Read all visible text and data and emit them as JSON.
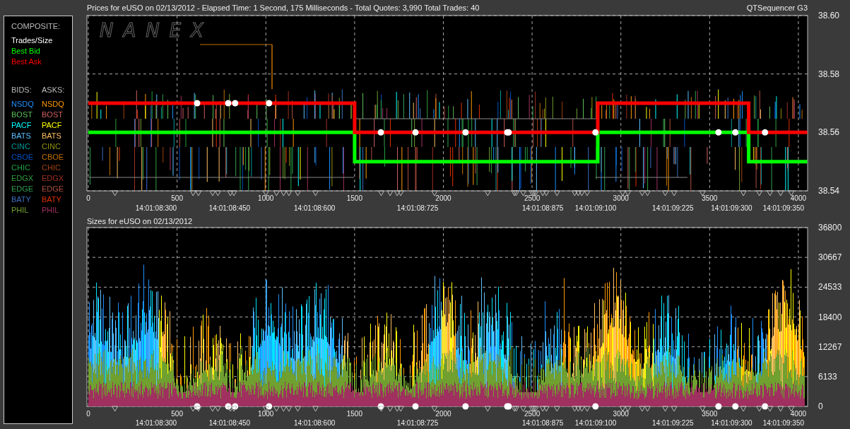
{
  "legend": {
    "composite_title": "COMPOSITE:",
    "trades_label": {
      "label": "Trades/Size",
      "color": "#ffffff"
    },
    "bids_title": "BIDS:",
    "asks_title": "ASKS:",
    "exchanges": [
      {
        "bid": {
          "label": "NSDQ",
          "color": "#1e90ff"
        },
        "ask": {
          "label": "NSDQ",
          "color": "#ff9900"
        }
      },
      {
        "bid": {
          "label": "BOST",
          "color": "#5cc05c"
        },
        "ask": {
          "label": "BOST",
          "color": "#d06060"
        }
      },
      {
        "bid": {
          "label": "PACF",
          "color": "#00ffff"
        },
        "ask": {
          "label": "PACF",
          "color": "#ffff00"
        }
      },
      {
        "bid": {
          "label": "BATS",
          "color": "#5bc0ff"
        },
        "ask": {
          "label": "BATS",
          "color": "#ffc060"
        }
      },
      {
        "bid": {
          "label": "CINC",
          "color": "#009999"
        },
        "ask": {
          "label": "CINC",
          "color": "#909010"
        }
      },
      {
        "bid": {
          "label": "CBOE",
          "color": "#0050c0"
        },
        "ask": {
          "label": "CBOE",
          "color": "#c07000"
        }
      },
      {
        "bid": {
          "label": "CHIC",
          "color": "#20a040"
        },
        "ask": {
          "label": "CHIC",
          "color": "#a04010"
        }
      },
      {
        "bid": {
          "label": "EDGX",
          "color": "#30a040"
        },
        "ask": {
          "label": "EDGX",
          "color": "#a03020"
        }
      },
      {
        "bid": {
          "label": "EDGE",
          "color": "#30a050"
        },
        "ask": {
          "label": "EDGE",
          "color": "#b05040"
        }
      },
      {
        "bid": {
          "label": "BATY",
          "color": "#3a70c0"
        },
        "ask": {
          "label": "BATY",
          "color": "#e03000"
        }
      },
      {
        "bid": {
          "label": "PHIL",
          "color": "#70a030"
        },
        "ask": {
          "label": "PHIL",
          "color": "#a03060"
        }
      }
    ]
  },
  "prices_panel": {
    "title": "Prices for eUSO on 02/13/2012 - Elapsed Time: 1 Second, 175 Milliseconds - Total Quotes: 3,990 Total Trades: 40",
    "app_name": "QTSequencer G3",
    "watermark": "NANEX",
    "time_labels": [
      "14:01:08:300",
      "14:01:08:450",
      "14:01:08:600",
      "14:01:08:725",
      "14:01:08:875",
      "14:01:09:100",
      "14:01:09:225",
      "14:01:09:300",
      "14:01:09:350"
    ],
    "chart_data": {
      "type": "line",
      "grid": true,
      "x": [
        0,
        1500,
        1500,
        2870,
        2870,
        3720,
        3720,
        4050
      ],
      "series": [
        {
          "name": "Best Bid",
          "color": "#00ff00",
          "values": [
            38.56,
            38.56,
            38.55,
            38.55,
            38.56,
            38.56,
            38.55,
            38.55
          ]
        },
        {
          "name": "Best Ask",
          "color": "#ff0000",
          "values": [
            38.57,
            38.57,
            38.56,
            38.56,
            38.57,
            38.57,
            38.56,
            38.56
          ]
        }
      ],
      "xlim": [
        -8,
        4052
      ],
      "ylim": [
        38.54,
        38.6
      ],
      "xticks": [
        0,
        500,
        1000,
        1500,
        2000,
        2500,
        3000,
        3500,
        4000
      ],
      "yticks": [
        {
          "value": 38.54,
          "label": "38.54"
        },
        {
          "value": 38.56,
          "label": "38.56"
        },
        {
          "value": 38.58,
          "label": "38.58"
        },
        {
          "value": 38.6,
          "label": "38.60"
        }
      ]
    }
  },
  "sizes_panel": {
    "title": "Sizes for eUSO on 02/13/2012",
    "y_axis_labels": [
      "36800",
      "30667",
      "24533",
      "18400",
      "12267",
      "6133",
      "0"
    ],
    "x_axis_labels": [
      "0",
      "500",
      "1000",
      "1500",
      "2000",
      "2500",
      "3000",
      "3500",
      "4000"
    ],
    "time_labels": [
      "14:01:08:300",
      "14:01:08:450",
      "14:01:08:600",
      "14:01:08:725",
      "14:01:08:875",
      "14:01:09:100",
      "14:01:09:225",
      "14:01:09:300",
      "14:01:09:350"
    ]
  }
}
